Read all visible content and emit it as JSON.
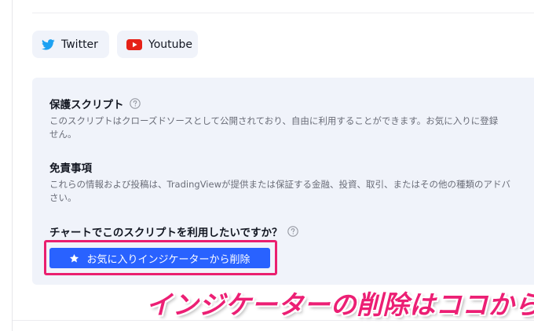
{
  "social": {
    "twitter_label": "Twitter",
    "youtube_label": "Youtube"
  },
  "protected_script": {
    "title": "保護スクリプト",
    "body_line1": "このスクリプトはクローズドソースとして公開されており、自由に利用することができます。お気に入りに登録",
    "body_line2": "せん。"
  },
  "disclaimer": {
    "title": "免責事項",
    "body_line1": "これらの情報および投稿は、TradingViewが提供または保証する金融、投資、取引、またはその他の種類のアドバ",
    "body_line2": "さい。"
  },
  "use_on_chart": {
    "question": "チャートでこのスクリプトを利用したいですか？",
    "button_label": "お気に入りインジケーターから削除"
  },
  "annotation": {
    "text": "インジケーターの削除はココから！"
  },
  "colors": {
    "accent": "#2962ff",
    "highlight": "#ea1f6f",
    "panel_bg": "#f0f3fa",
    "twitter_blue": "#1da1f2",
    "youtube_red": "#e62117"
  },
  "icons": {
    "twitter": "twitter-bird-icon",
    "youtube": "youtube-play-icon",
    "help": "question-circle-icon",
    "star": "star-icon"
  }
}
